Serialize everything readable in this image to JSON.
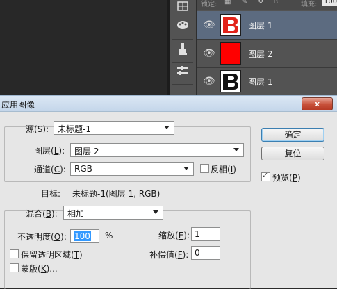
{
  "photoshop": {
    "lock_label": "锁定:",
    "lock_icons": "▦ ✎ ✥ ⚿",
    "fill_label": "填充:",
    "fill_value": "100",
    "tools": [
      "grid-icon",
      "brushes-icon",
      "clone-icon",
      "adjust-icon"
    ],
    "layers": [
      {
        "name": "图层 1",
        "selected": true,
        "thumb": "logo-red"
      },
      {
        "name": "图层 2",
        "selected": false,
        "thumb": "red-fill"
      },
      {
        "name": "图层 1",
        "selected": false,
        "thumb": "logo-black"
      }
    ]
  },
  "dialog": {
    "title": "应用图像",
    "close_label": "x",
    "source": {
      "label": "源",
      "key": "S",
      "value": "未标题-1"
    },
    "layer": {
      "label": "图层",
      "key": "L",
      "value": "图层 2"
    },
    "channel": {
      "label": "通道",
      "key": "C",
      "value": "RGB"
    },
    "invert": {
      "label": "反相",
      "key": "I",
      "checked": false
    },
    "target": {
      "label": "目标:",
      "value": "未标题-1(图层 1, RGB)"
    },
    "blending": {
      "label": "混合",
      "key": "B",
      "value": "相加"
    },
    "opacity": {
      "label": "不透明度",
      "key": "O",
      "value": "100",
      "unit": "%"
    },
    "scale": {
      "label": "缩放",
      "key": "E",
      "value": "1"
    },
    "offset": {
      "label": "补偿值",
      "key": "F",
      "value": "0"
    },
    "preserve_transparency": {
      "label": "保留透明区域",
      "key": "T",
      "checked": false
    },
    "mask": {
      "label": "蒙版",
      "key": "K",
      "suffix": "...",
      "checked": false
    },
    "ok_label": "确定",
    "reset_label": "复位",
    "preview": {
      "label": "预览",
      "key": "P",
      "checked": true
    }
  }
}
